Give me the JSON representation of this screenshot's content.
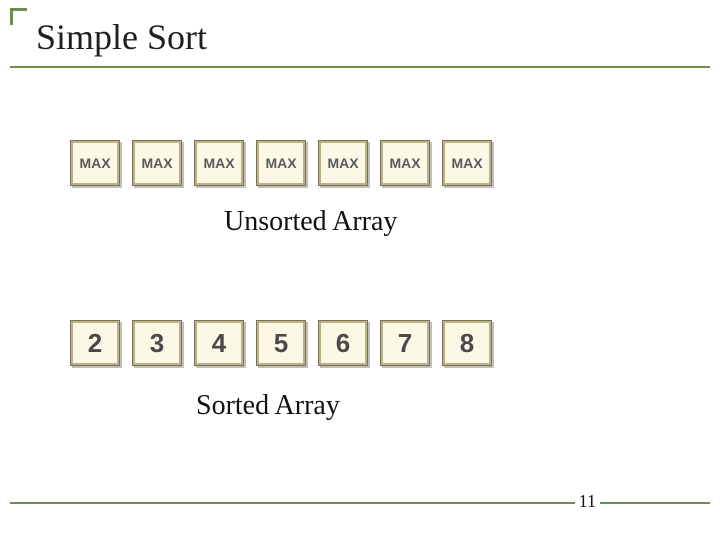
{
  "title": "Simple Sort",
  "unsorted": {
    "cells": [
      "MAX",
      "MAX",
      "MAX",
      "MAX",
      "MAX",
      "MAX",
      "MAX"
    ],
    "caption": "Unsorted Array"
  },
  "sorted": {
    "cells": [
      "2",
      "3",
      "4",
      "5",
      "6",
      "7",
      "8"
    ],
    "caption": "Sorted Array"
  },
  "page_number": "11"
}
